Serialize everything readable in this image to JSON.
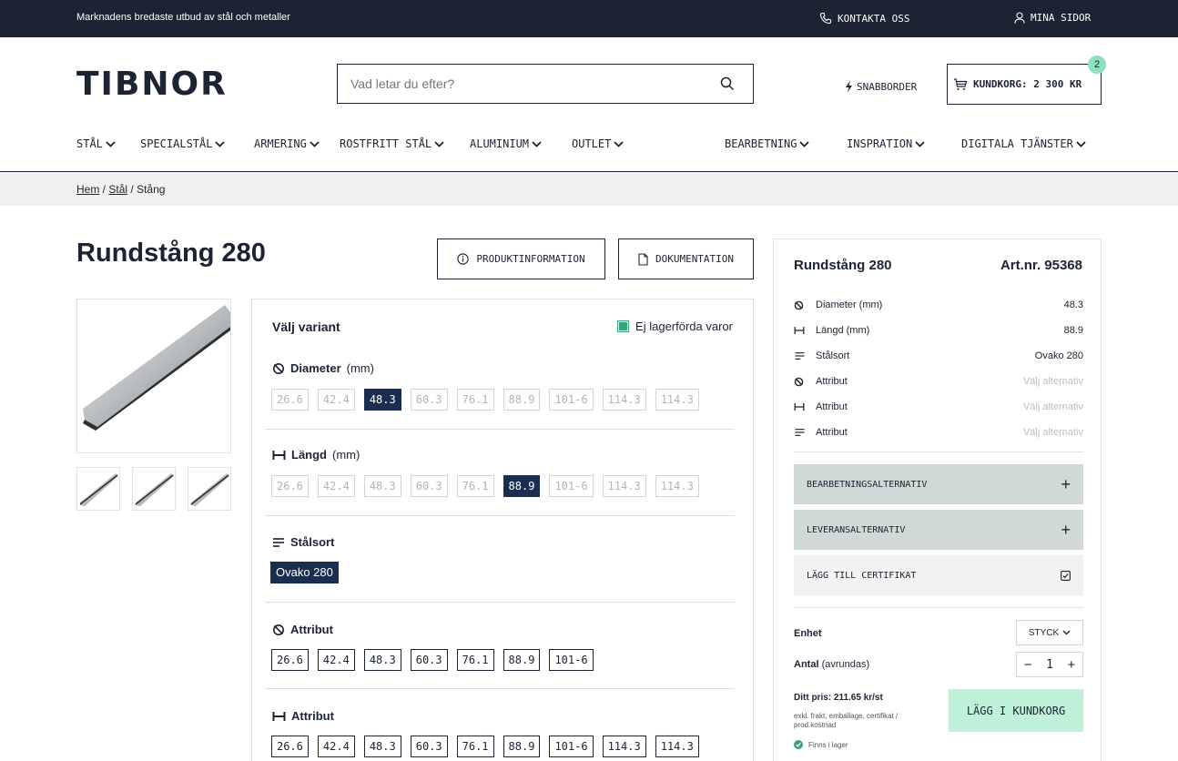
{
  "topbar": {
    "message": "Marknadens bredaste utbud av stål och metaller",
    "contact": "KONTAKTA OSS",
    "my_pages": "MINA SIDOR"
  },
  "header": {
    "logo": "TIBNOR",
    "search_placeholder": "Vad letar du efter?",
    "quick_order": "SNABBORDER",
    "cart_label": "KUNDKORG: 2 300 KR",
    "cart_count": "2"
  },
  "nav": {
    "items": [
      "STÅL",
      "SPECIALSTÅL",
      "ARMERING",
      "ROSTFRITT STÅL",
      "ALUMINIUM",
      "OUTLET",
      "BEARBETNING",
      "INSPRATION",
      "DIGITALA TJÄNSTER"
    ]
  },
  "breadcrumb": {
    "home": "Hem",
    "sep1": " / ",
    "steel": "Stål",
    "sep2": " / ",
    "current": "Stång"
  },
  "product": {
    "title": "Rundstång 280",
    "info_button": "PRODUKTINFORMATION",
    "doc_button": "DOKUMENTATION"
  },
  "variant": {
    "heading": "Välj variant",
    "non_stock": "Ej lagerförda varor",
    "diameter_label": "Diameter",
    "diameter_unit": "(mm)",
    "diameter_options": [
      "26.6",
      "42.4",
      "48.3",
      "60.3",
      "76.1",
      "88.9",
      "101-6",
      "114.3",
      "114.3"
    ],
    "diameter_selected": "48.3",
    "length_label": "Längd",
    "length_unit": "(mm)",
    "length_options": [
      "26.6",
      "42.4",
      "48.3",
      "60.3",
      "76.1",
      "88.9",
      "101-6",
      "114.3",
      "114.3"
    ],
    "length_selected": "88.9",
    "steel_label": "Stålsort",
    "steel_value": "Ovako 280",
    "attr1_label": "Attribut",
    "attr1_options": [
      "26.6",
      "42.4",
      "48.3",
      "60.3",
      "76.1",
      "88.9",
      "101-6"
    ],
    "attr2_label": "Attribut",
    "attr2_options": [
      "26.6",
      "42.4",
      "48.3",
      "60.3",
      "76.1",
      "88.9",
      "101-6",
      "114.3",
      "114.3"
    ]
  },
  "summary": {
    "title": "Rundstång 280",
    "artnr": "Art.nr. 95368",
    "rows": [
      {
        "icon": "diameter-icon",
        "label": "Diameter (mm)",
        "value": "48.3",
        "muted": false
      },
      {
        "icon": "length-icon",
        "label": "Längd (mm)",
        "value": "88.9",
        "muted": false
      },
      {
        "icon": "lines-icon",
        "label": "Stålsort",
        "value": "Ovako 280",
        "muted": false
      },
      {
        "icon": "diameter-icon",
        "label": "Attribut",
        "value": "Välj alternativ",
        "muted": true
      },
      {
        "icon": "length-icon",
        "label": "Attribut",
        "value": "Välj alternativ",
        "muted": true
      },
      {
        "icon": "lines-icon",
        "label": "Attribut",
        "value": "Välj alternativ",
        "muted": true
      }
    ],
    "processing": "BEARBETNINGSALTERNATIV",
    "delivery": "LEVERANSALTERNATIV",
    "certificate": "LÄGG TILL CERTIFIKAT",
    "unit_label": "Enhet",
    "unit_value": "STYCK",
    "qty_label": "Antal",
    "qty_hint": "(avrundas)",
    "qty_value": "1",
    "qty_minus": "−",
    "qty_plus": "+",
    "price": "Ditt pris: 211.65 kr/st",
    "price_note": "exkl. frakt, emballage, certifikat / prod.kostnad",
    "add_to_cart": "LÄGG I KUNDKORG",
    "stock": "Finns i lager"
  },
  "colors": {
    "navy": "#1c2333",
    "selected": "#1c2d52",
    "accent_green": "#bff0d8",
    "badge": "#8fe0bf",
    "accordion": "#d0d9d6"
  }
}
